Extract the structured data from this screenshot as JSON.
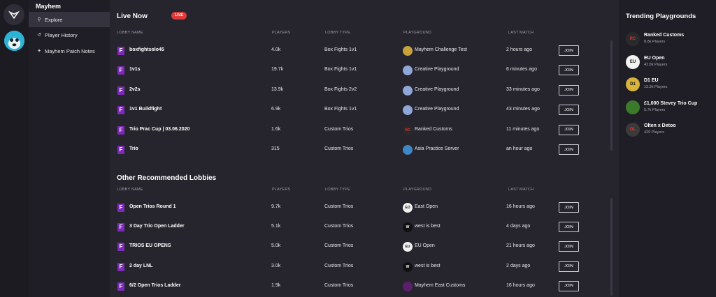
{
  "nav": {
    "title": "Mayhem",
    "items": [
      {
        "label": "Explore",
        "icon": "search-icon"
      },
      {
        "label": "Player History",
        "icon": "history-icon"
      },
      {
        "label": "Mayhem Patch Notes",
        "icon": "sparkle-icon"
      }
    ]
  },
  "live": {
    "title": "Live Now",
    "badge": "LIVE",
    "headers": {
      "name": "LOBBY NAME",
      "players": "PLAYERS",
      "type": "LOBBY TYPE",
      "playground": "PLAYGROUND",
      "last": "LAST MATCH"
    },
    "rows": [
      {
        "name": "boxfightsolo45",
        "players": "4.0k",
        "type": "Box Fights 1v1",
        "playground": "Mayhem Challenge Test",
        "last": "2 hours ago",
        "join": "JOIN",
        "icon": "mayhem-challenge-icon"
      },
      {
        "name": "1v1s",
        "players": "19.7k",
        "type": "Box Fights 1v1",
        "playground": "Creative Playground",
        "last": "6 minutes ago",
        "join": "JOIN",
        "icon": "creative-icon"
      },
      {
        "name": "2v2s",
        "players": "13.9k",
        "type": "Box Fights 2v2",
        "playground": "Creative Playground",
        "last": "33 minutes ago",
        "join": "JOIN",
        "icon": "creative-icon"
      },
      {
        "name": "1v1 Buildfight",
        "players": "6.9k",
        "type": "Box Fights 1v1",
        "playground": "Creative Playground",
        "last": "43 minutes ago",
        "join": "JOIN",
        "icon": "creative-icon"
      },
      {
        "name": "Trio Prac Cup | 03.06.2020",
        "players": "1.6k",
        "type": "Custom Trios",
        "playground": "Ranked Customs",
        "last": "11 minutes ago",
        "join": "JOIN",
        "icon": "ranked-customs-icon"
      },
      {
        "name": "Trio",
        "players": "315",
        "type": "Custom Trios",
        "playground": "Asia Practice Server",
        "last": "an hour ago",
        "join": "JOIN",
        "icon": "asia-server-icon"
      }
    ]
  },
  "recommended": {
    "title": "Other Recommended Lobbies",
    "headers": {
      "name": "LOBBY NAME",
      "players": "PLAYERS",
      "type": "LOBBY TYPE",
      "playground": "PLAYGROUND",
      "last": "LAST MATCH"
    },
    "rows": [
      {
        "name": "Open Trios Round 1",
        "players": "9.7k",
        "type": "Custom Trios",
        "playground": "East Open",
        "last": "16 hours ago",
        "join": "JOIN",
        "icon": "east-open-icon"
      },
      {
        "name": "3 Day Trio Open Ladder",
        "players": "5.1k",
        "type": "Custom Trios",
        "playground": "west is best",
        "last": "4 days ago",
        "join": "JOIN",
        "icon": "west-is-best-icon"
      },
      {
        "name": "TRIOS EU OPENS",
        "players": "5.0k",
        "type": "Custom Trios",
        "playground": "EU Open",
        "last": "21 hours ago",
        "join": "JOIN",
        "icon": "eu-open-icon"
      },
      {
        "name": "2 day LNL",
        "players": "3.0k",
        "type": "Custom Trios",
        "playground": "west is best",
        "last": "2 days ago",
        "join": "JOIN",
        "icon": "west-is-best-icon"
      },
      {
        "name": "6/2 Open Trios Ladder",
        "players": "1.9k",
        "type": "Custom Trios",
        "playground": "Mayhem East Customs",
        "last": "16 hours ago",
        "join": "JOIN",
        "icon": "mayhem-east-icon"
      }
    ]
  },
  "trending": {
    "title": "Trending Playgrounds",
    "items": [
      {
        "name": "Ranked Customs",
        "players": "8.8k Players",
        "icon": "ranked-customs-icon"
      },
      {
        "name": "EU Open",
        "players": "42.8k Players",
        "icon": "eu-open-icon"
      },
      {
        "name": "D1 EU",
        "players": "13.9k Players",
        "icon": "d1-eu-icon"
      },
      {
        "name": "£1,000 Stevey Trio Cup",
        "players": "5.7k Players",
        "icon": "stevey-cup-icon"
      },
      {
        "name": "Olten x Detoo",
        "players": "429 Players",
        "icon": "olten-detoo-icon"
      }
    ]
  },
  "colors": {
    "accent": "#7d2ab8",
    "live": "#e03a3a",
    "bg": "#26252e"
  }
}
